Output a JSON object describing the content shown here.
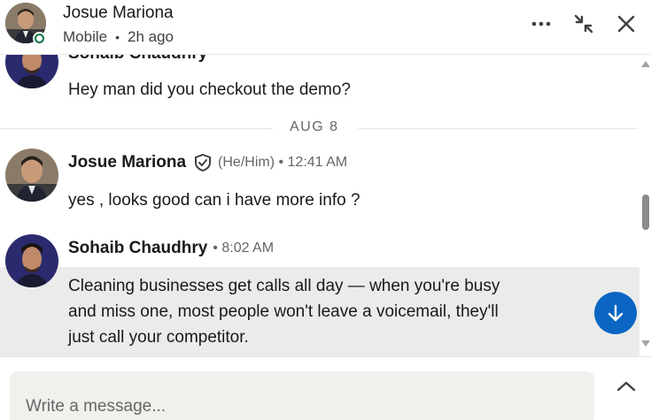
{
  "header": {
    "name": "Josue Mariona",
    "status": "Mobile",
    "separator": "•",
    "time_ago": "2h ago",
    "actions": [
      "more-options-icon",
      "minimize-icon",
      "close-icon"
    ]
  },
  "thread": {
    "partial_sender": "Sohaib Chaudhry",
    "partial_message": "Hey man did you checkout the demo?",
    "date_divider": "AUG 8",
    "messages": [
      {
        "sender": "Josue Mariona",
        "verified": true,
        "meta": "(He/Him) • 12:41 AM",
        "text": "yes , looks good can i have more info ?"
      },
      {
        "sender": "Sohaib Chaudhry",
        "verified": false,
        "meta": "• 8:02 AM",
        "lines": [
          "Cleaning businesses get calls all day — when you're busy",
          "and miss one, most people won't leave a voicemail, they'll",
          "just call your competitor."
        ]
      }
    ]
  },
  "composer": {
    "placeholder": "Write a message..."
  },
  "colors": {
    "accent": "#0a66c2",
    "presence": "#057642",
    "highlight": "#ebebeb"
  }
}
